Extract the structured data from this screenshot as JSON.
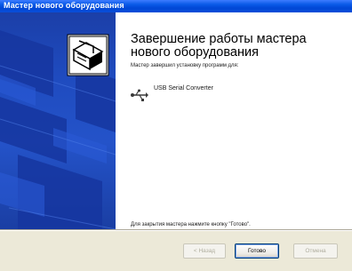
{
  "window": {
    "title": "Мастер нового оборудования"
  },
  "wizard": {
    "heading": "Завершение работы мастера нового оборудования",
    "install_done_text": "Мастер завершил установку программ для:",
    "device_name": "USB Serial Converter",
    "device_icon": "usb-icon",
    "closing_text": "Для закрытия мастера нажмите кнопку \"Готово\"."
  },
  "buttons": {
    "back_label": "< Назад",
    "finish_label": "Готово",
    "cancel_label": "Отмена"
  },
  "colors": {
    "title_bar": "#0a5be8",
    "side_panel": "#1f4bbf",
    "dialog_bg": "#ece9d8"
  }
}
